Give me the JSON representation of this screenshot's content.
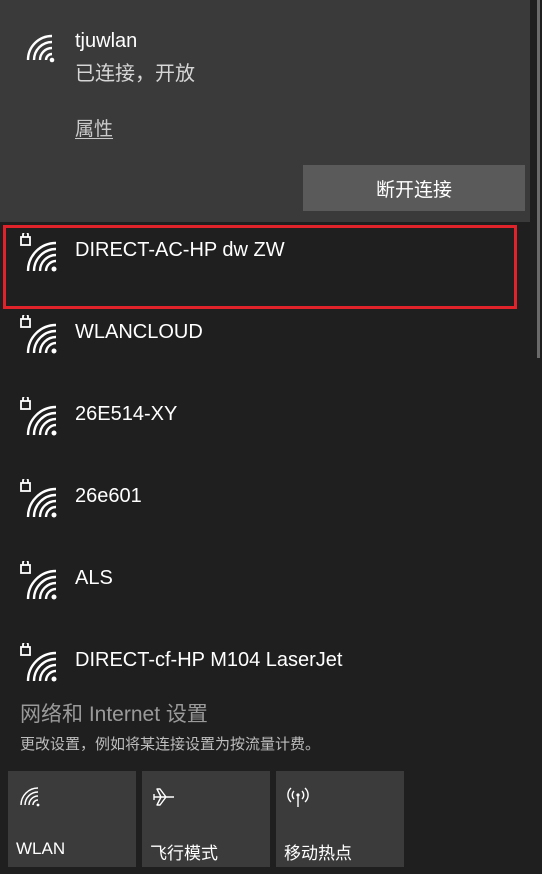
{
  "connected_network": {
    "ssid": "tjuwlan",
    "status": "已连接，开放",
    "properties_link": "属性",
    "disconnect_button": "断开连接",
    "icon": "wifi-icon"
  },
  "networks": [
    {
      "name": "DIRECT-AC-HP dw ZW",
      "icon": "wifi-secured-icon",
      "highlighted": true
    },
    {
      "name": "WLANCLOUD",
      "icon": "wifi-secured-icon"
    },
    {
      "name": "26E514-XY",
      "icon": "wifi-secured-icon"
    },
    {
      "name": "26e601",
      "icon": "wifi-secured-icon"
    },
    {
      "name": "ALS",
      "icon": "wifi-secured-icon"
    },
    {
      "name": "DIRECT-cf-HP M104 LaserJet",
      "icon": "wifi-secured-icon"
    }
  ],
  "settings": {
    "link": "网络和 Internet 设置",
    "description": "更改设置，例如将某连接设置为按流量计费。"
  },
  "quick_actions": [
    {
      "label": "WLAN",
      "icon": "wifi-icon"
    },
    {
      "label": "飞行模式",
      "icon": "airplane-icon"
    },
    {
      "label": "移动热点",
      "icon": "hotspot-icon"
    }
  ],
  "colors": {
    "background": "#1f1f1f",
    "connected_bg": "#3a3a3a",
    "button_bg": "#5a5a5a",
    "highlight_border": "#e0222a",
    "tile_bg": "#3b3b3b"
  }
}
